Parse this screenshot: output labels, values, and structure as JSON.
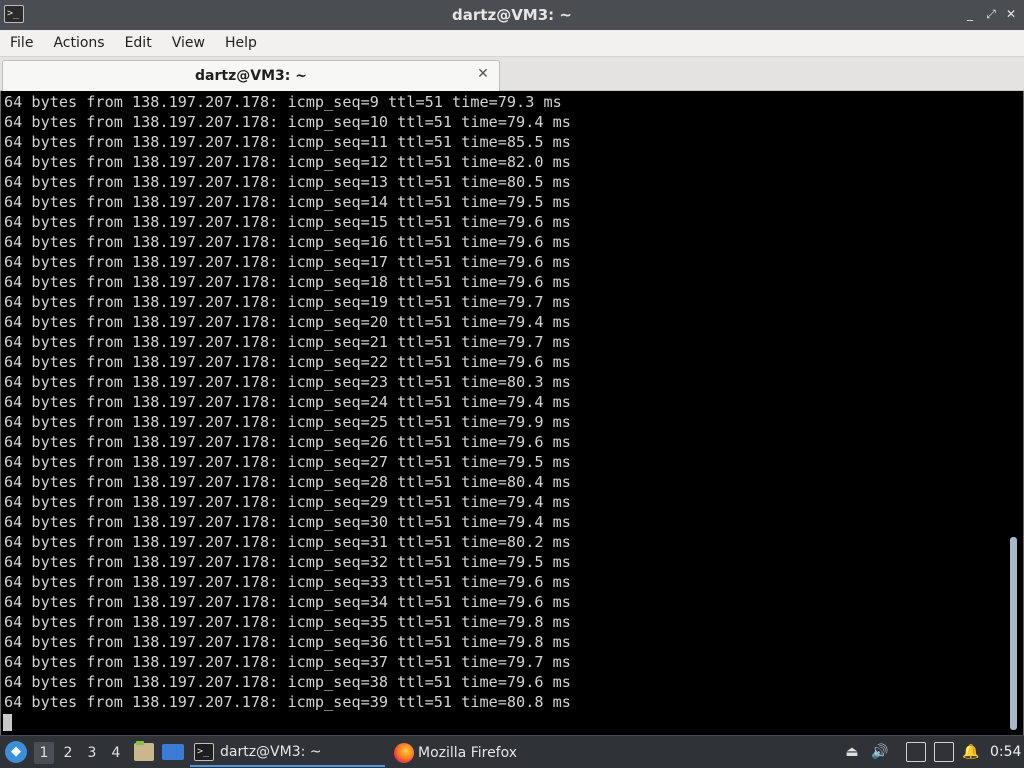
{
  "window": {
    "title": "dartz@VM3: ~",
    "app_icon_glyph": ">_",
    "controls": {
      "minimize": "_",
      "maximize": "⤢",
      "close": "✕"
    }
  },
  "menu": [
    "File",
    "Actions",
    "Edit",
    "View",
    "Help"
  ],
  "tab": {
    "label": "dartz@VM3: ~",
    "close_glyph": "✕"
  },
  "terminal": {
    "lines": [
      "64 bytes from 138.197.207.178: icmp_seq=9 ttl=51 time=79.3 ms",
      "64 bytes from 138.197.207.178: icmp_seq=10 ttl=51 time=79.4 ms",
      "64 bytes from 138.197.207.178: icmp_seq=11 ttl=51 time=85.5 ms",
      "64 bytes from 138.197.207.178: icmp_seq=12 ttl=51 time=82.0 ms",
      "64 bytes from 138.197.207.178: icmp_seq=13 ttl=51 time=80.5 ms",
      "64 bytes from 138.197.207.178: icmp_seq=14 ttl=51 time=79.5 ms",
      "64 bytes from 138.197.207.178: icmp_seq=15 ttl=51 time=79.6 ms",
      "64 bytes from 138.197.207.178: icmp_seq=16 ttl=51 time=79.6 ms",
      "64 bytes from 138.197.207.178: icmp_seq=17 ttl=51 time=79.6 ms",
      "64 bytes from 138.197.207.178: icmp_seq=18 ttl=51 time=79.6 ms",
      "64 bytes from 138.197.207.178: icmp_seq=19 ttl=51 time=79.7 ms",
      "64 bytes from 138.197.207.178: icmp_seq=20 ttl=51 time=79.4 ms",
      "64 bytes from 138.197.207.178: icmp_seq=21 ttl=51 time=79.7 ms",
      "64 bytes from 138.197.207.178: icmp_seq=22 ttl=51 time=79.6 ms",
      "64 bytes from 138.197.207.178: icmp_seq=23 ttl=51 time=80.3 ms",
      "64 bytes from 138.197.207.178: icmp_seq=24 ttl=51 time=79.4 ms",
      "64 bytes from 138.197.207.178: icmp_seq=25 ttl=51 time=79.9 ms",
      "64 bytes from 138.197.207.178: icmp_seq=26 ttl=51 time=79.6 ms",
      "64 bytes from 138.197.207.178: icmp_seq=27 ttl=51 time=79.5 ms",
      "64 bytes from 138.197.207.178: icmp_seq=28 ttl=51 time=80.4 ms",
      "64 bytes from 138.197.207.178: icmp_seq=29 ttl=51 time=79.4 ms",
      "64 bytes from 138.197.207.178: icmp_seq=30 ttl=51 time=79.4 ms",
      "64 bytes from 138.197.207.178: icmp_seq=31 ttl=51 time=80.2 ms",
      "64 bytes from 138.197.207.178: icmp_seq=32 ttl=51 time=79.5 ms",
      "64 bytes from 138.197.207.178: icmp_seq=33 ttl=51 time=79.6 ms",
      "64 bytes from 138.197.207.178: icmp_seq=34 ttl=51 time=79.6 ms",
      "64 bytes from 138.197.207.178: icmp_seq=35 ttl=51 time=79.8 ms",
      "64 bytes from 138.197.207.178: icmp_seq=36 ttl=51 time=79.8 ms",
      "64 bytes from 138.197.207.178: icmp_seq=37 ttl=51 time=79.7 ms",
      "64 bytes from 138.197.207.178: icmp_seq=38 ttl=51 time=79.6 ms",
      "64 bytes from 138.197.207.178: icmp_seq=39 ttl=51 time=80.8 ms"
    ]
  },
  "taskbar": {
    "workspaces": [
      "1",
      "2",
      "3",
      "4"
    ],
    "active_workspace": "1",
    "tasks": [
      {
        "label": "dartz@VM3: ~",
        "icon": "terminal-icon"
      },
      {
        "label": "Mozilla Firefox",
        "icon": "firefox-icon"
      }
    ],
    "tray_icons": [
      "eject-icon",
      "volume-icon",
      "clipboard-icon",
      "network-icon",
      "notification-icon"
    ],
    "clock": "0:54"
  },
  "colors": {
    "terminal_bg": "#000000",
    "terminal_fg": "#d3d3d3",
    "titlebar_bg": "#4a4d52",
    "taskbar_bg": "#2f3237",
    "accent": "#5294e2"
  }
}
